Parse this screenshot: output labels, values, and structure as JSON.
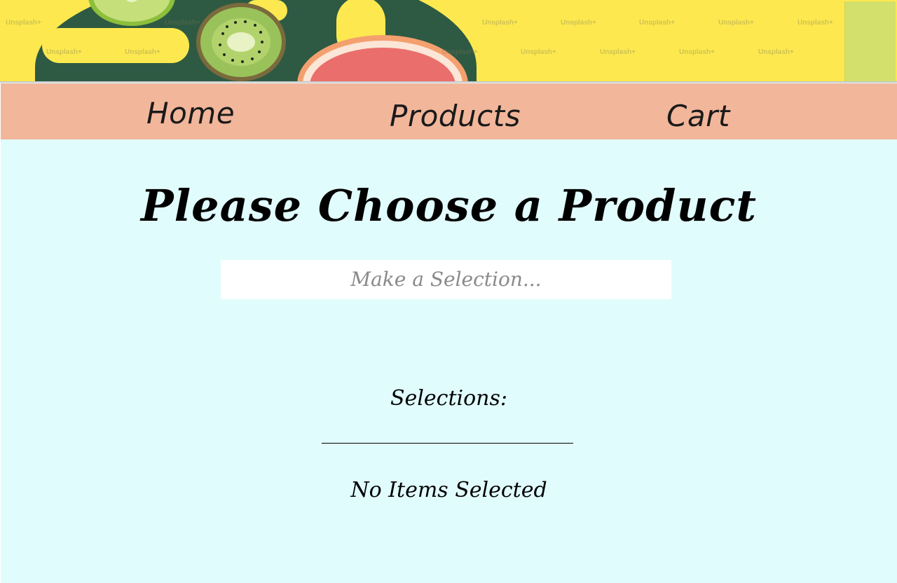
{
  "hero": {
    "watermark_text": "Unsplash+"
  },
  "nav": {
    "items": [
      {
        "label": "Home"
      },
      {
        "label": "Products"
      },
      {
        "label": "Cart"
      }
    ]
  },
  "main": {
    "title": "Please Choose a Product",
    "select_placeholder": "Make a Selection...",
    "selections_heading": "Selections:",
    "empty_message": "No Items Selected"
  },
  "colors": {
    "hero_background": "#fde94f",
    "nav_background": "#f2b69b",
    "page_background": "#e1fcfd",
    "select_background": "#ffffff"
  }
}
